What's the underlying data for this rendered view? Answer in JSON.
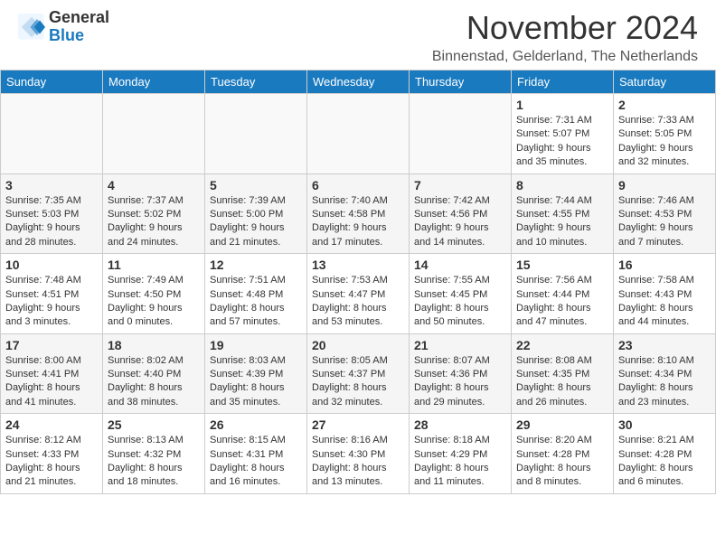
{
  "header": {
    "logo_general": "General",
    "logo_blue": "Blue",
    "month_title": "November 2024",
    "location": "Binnenstad, Gelderland, The Netherlands"
  },
  "calendar": {
    "days_of_week": [
      "Sunday",
      "Monday",
      "Tuesday",
      "Wednesday",
      "Thursday",
      "Friday",
      "Saturday"
    ],
    "weeks": [
      [
        {
          "day": "",
          "info": ""
        },
        {
          "day": "",
          "info": ""
        },
        {
          "day": "",
          "info": ""
        },
        {
          "day": "",
          "info": ""
        },
        {
          "day": "",
          "info": ""
        },
        {
          "day": "1",
          "info": "Sunrise: 7:31 AM\nSunset: 5:07 PM\nDaylight: 9 hours and 35 minutes."
        },
        {
          "day": "2",
          "info": "Sunrise: 7:33 AM\nSunset: 5:05 PM\nDaylight: 9 hours and 32 minutes."
        }
      ],
      [
        {
          "day": "3",
          "info": "Sunrise: 7:35 AM\nSunset: 5:03 PM\nDaylight: 9 hours and 28 minutes."
        },
        {
          "day": "4",
          "info": "Sunrise: 7:37 AM\nSunset: 5:02 PM\nDaylight: 9 hours and 24 minutes."
        },
        {
          "day": "5",
          "info": "Sunrise: 7:39 AM\nSunset: 5:00 PM\nDaylight: 9 hours and 21 minutes."
        },
        {
          "day": "6",
          "info": "Sunrise: 7:40 AM\nSunset: 4:58 PM\nDaylight: 9 hours and 17 minutes."
        },
        {
          "day": "7",
          "info": "Sunrise: 7:42 AM\nSunset: 4:56 PM\nDaylight: 9 hours and 14 minutes."
        },
        {
          "day": "8",
          "info": "Sunrise: 7:44 AM\nSunset: 4:55 PM\nDaylight: 9 hours and 10 minutes."
        },
        {
          "day": "9",
          "info": "Sunrise: 7:46 AM\nSunset: 4:53 PM\nDaylight: 9 hours and 7 minutes."
        }
      ],
      [
        {
          "day": "10",
          "info": "Sunrise: 7:48 AM\nSunset: 4:51 PM\nDaylight: 9 hours and 3 minutes."
        },
        {
          "day": "11",
          "info": "Sunrise: 7:49 AM\nSunset: 4:50 PM\nDaylight: 9 hours and 0 minutes."
        },
        {
          "day": "12",
          "info": "Sunrise: 7:51 AM\nSunset: 4:48 PM\nDaylight: 8 hours and 57 minutes."
        },
        {
          "day": "13",
          "info": "Sunrise: 7:53 AM\nSunset: 4:47 PM\nDaylight: 8 hours and 53 minutes."
        },
        {
          "day": "14",
          "info": "Sunrise: 7:55 AM\nSunset: 4:45 PM\nDaylight: 8 hours and 50 minutes."
        },
        {
          "day": "15",
          "info": "Sunrise: 7:56 AM\nSunset: 4:44 PM\nDaylight: 8 hours and 47 minutes."
        },
        {
          "day": "16",
          "info": "Sunrise: 7:58 AM\nSunset: 4:43 PM\nDaylight: 8 hours and 44 minutes."
        }
      ],
      [
        {
          "day": "17",
          "info": "Sunrise: 8:00 AM\nSunset: 4:41 PM\nDaylight: 8 hours and 41 minutes."
        },
        {
          "day": "18",
          "info": "Sunrise: 8:02 AM\nSunset: 4:40 PM\nDaylight: 8 hours and 38 minutes."
        },
        {
          "day": "19",
          "info": "Sunrise: 8:03 AM\nSunset: 4:39 PM\nDaylight: 8 hours and 35 minutes."
        },
        {
          "day": "20",
          "info": "Sunrise: 8:05 AM\nSunset: 4:37 PM\nDaylight: 8 hours and 32 minutes."
        },
        {
          "day": "21",
          "info": "Sunrise: 8:07 AM\nSunset: 4:36 PM\nDaylight: 8 hours and 29 minutes."
        },
        {
          "day": "22",
          "info": "Sunrise: 8:08 AM\nSunset: 4:35 PM\nDaylight: 8 hours and 26 minutes."
        },
        {
          "day": "23",
          "info": "Sunrise: 8:10 AM\nSunset: 4:34 PM\nDaylight: 8 hours and 23 minutes."
        }
      ],
      [
        {
          "day": "24",
          "info": "Sunrise: 8:12 AM\nSunset: 4:33 PM\nDaylight: 8 hours and 21 minutes."
        },
        {
          "day": "25",
          "info": "Sunrise: 8:13 AM\nSunset: 4:32 PM\nDaylight: 8 hours and 18 minutes."
        },
        {
          "day": "26",
          "info": "Sunrise: 8:15 AM\nSunset: 4:31 PM\nDaylight: 8 hours and 16 minutes."
        },
        {
          "day": "27",
          "info": "Sunrise: 8:16 AM\nSunset: 4:30 PM\nDaylight: 8 hours and 13 minutes."
        },
        {
          "day": "28",
          "info": "Sunrise: 8:18 AM\nSunset: 4:29 PM\nDaylight: 8 hours and 11 minutes."
        },
        {
          "day": "29",
          "info": "Sunrise: 8:20 AM\nSunset: 4:28 PM\nDaylight: 8 hours and 8 minutes."
        },
        {
          "day": "30",
          "info": "Sunrise: 8:21 AM\nSunset: 4:28 PM\nDaylight: 8 hours and 6 minutes."
        }
      ]
    ]
  }
}
